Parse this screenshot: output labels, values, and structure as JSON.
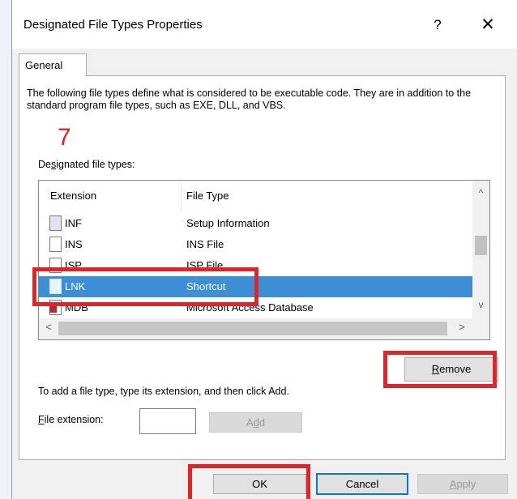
{
  "window": {
    "title": "Designated File Types Properties",
    "help_glyph": "?",
    "close_glyph": "✕"
  },
  "tabs": [
    {
      "label": "General",
      "selected": true
    }
  ],
  "description": "The following file types define what is considered to be executable code. They are in addition to the standard program file types, such as EXE, DLL, and VBS.",
  "annotation_number": "7",
  "designated_label": "Designated file types:",
  "list": {
    "columns": [
      "Extension",
      "File Type"
    ],
    "rows": [
      {
        "extension": "INF",
        "file_type": "Setup Information",
        "icon": "setup-file-icon",
        "selected": false
      },
      {
        "extension": "INS",
        "file_type": "INS File",
        "icon": "generic-file-icon",
        "selected": false
      },
      {
        "extension": "ISP",
        "file_type": "ISP File",
        "icon": "generic-file-icon",
        "selected": false
      },
      {
        "extension": "LNK",
        "file_type": "Shortcut",
        "icon": "generic-file-icon",
        "selected": true
      },
      {
        "extension": "MDB",
        "file_type": "Microsoft Access Database",
        "icon": "access-file-icon",
        "selected": false
      }
    ],
    "scroll_up": "^",
    "scroll_down": "v",
    "scroll_left": "<",
    "scroll_right": ">"
  },
  "buttons": {
    "remove": "Remove",
    "add": "Add",
    "ok": "OK",
    "cancel": "Cancel",
    "apply": "Apply"
  },
  "add_instruction": "To add a file type, type its extension, and then click Add.",
  "file_extension_label": "File extension:",
  "file_extension_value": "",
  "colors": {
    "selection": "#3c8fd4",
    "highlight_box": "#e0242b",
    "default_button_border": "#0078d7"
  }
}
